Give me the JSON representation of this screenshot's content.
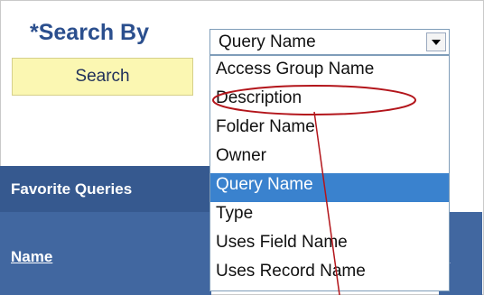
{
  "form": {
    "search_by_label": "*Search By",
    "search_button_label": "Search"
  },
  "select": {
    "current_value": "Query Name",
    "options": [
      "Access Group Name",
      "Description",
      "Folder Name",
      "Owner",
      "Query Name",
      "Type",
      "Uses Field Name",
      "Uses Record Name"
    ],
    "selected_option": "Query Name"
  },
  "favorites_section": {
    "header": "Favorite Queries",
    "column_name": "Name",
    "column_partial": "ti"
  },
  "annotation": {
    "color": "#b3151b",
    "target": "Description"
  },
  "colors": {
    "label_blue": "#2b4f8e",
    "button_yellow": "#fbf7b2",
    "header_blue": "#36598f",
    "selected_highlight": "#3a82ce"
  }
}
